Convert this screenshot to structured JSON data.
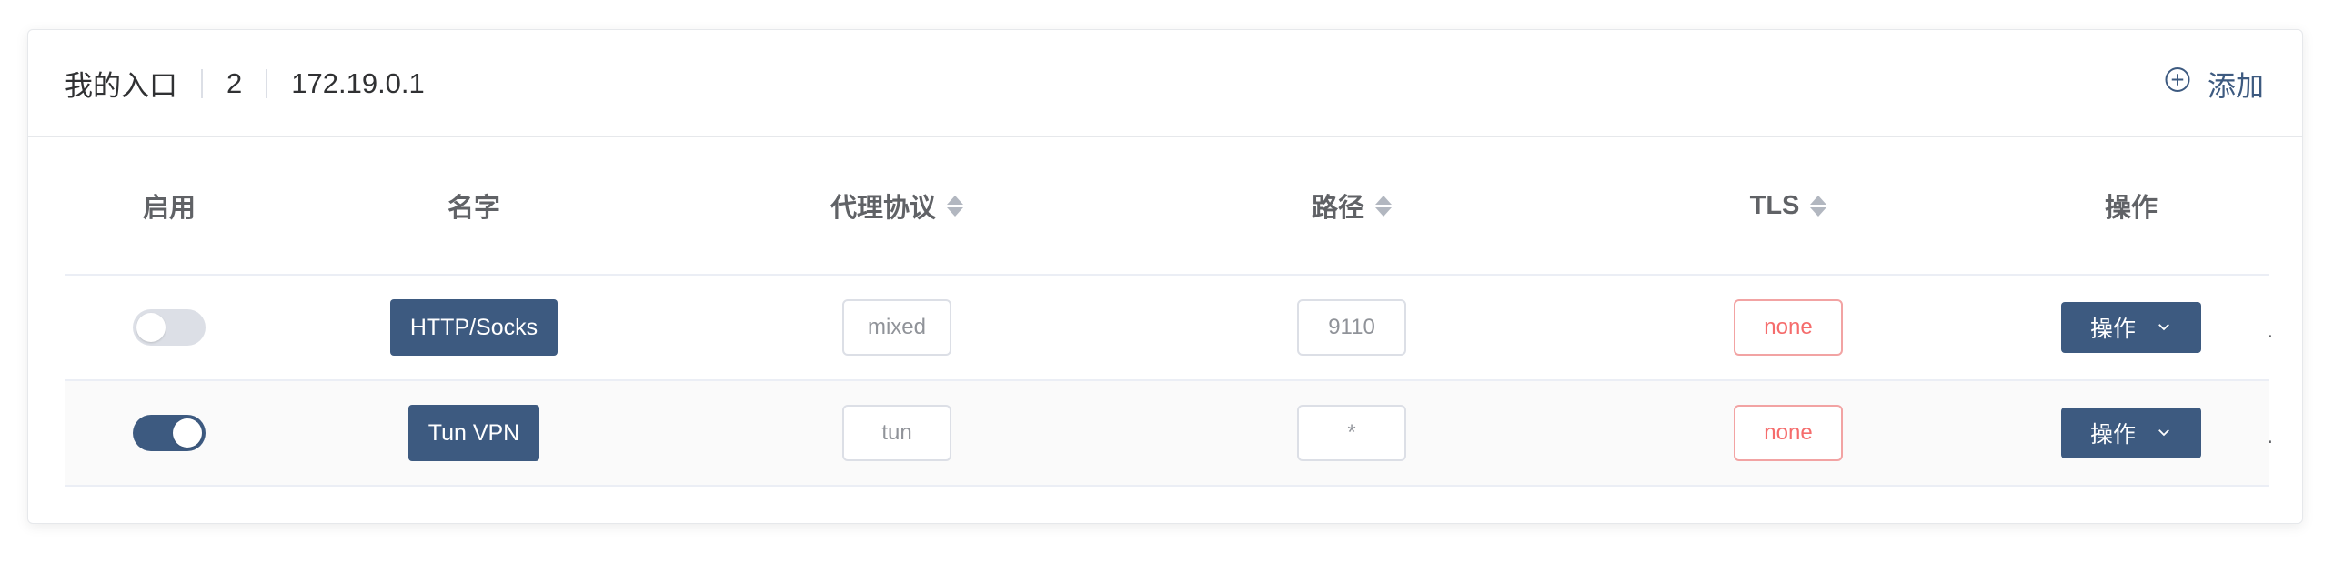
{
  "header": {
    "title": "我的入口",
    "count": "2",
    "ip": "172.19.0.1",
    "add_label": "添加"
  },
  "table": {
    "columns": {
      "enabled": "启用",
      "name": "名字",
      "protocol": "代理协议",
      "path": "路径",
      "tls": "TLS",
      "actions": "操作"
    },
    "rows": [
      {
        "enabled": false,
        "name": "HTTP/Socks",
        "protocol": "mixed",
        "path": "9110",
        "tls": "none",
        "action": "操作"
      },
      {
        "enabled": true,
        "name": "Tun VPN",
        "protocol": "tun",
        "path": "*",
        "tls": "none",
        "action": "操作"
      }
    ]
  },
  "colors": {
    "primary": "#3d5a80",
    "danger": "#f56c6c",
    "switch_off": "#dcdfe6"
  }
}
